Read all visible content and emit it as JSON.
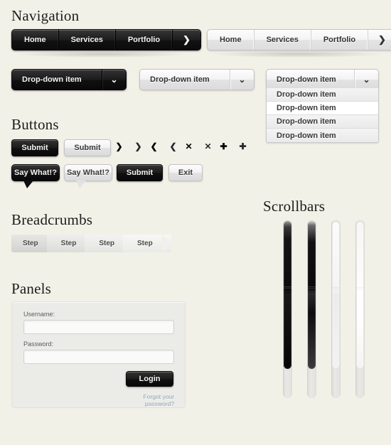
{
  "sections": {
    "navigation": "Navigation",
    "buttons": "Buttons",
    "breadcrumbs": "Breadcrumbs",
    "panels": "Panels",
    "scrollbars": "Scrollbars"
  },
  "navbar_dark": {
    "items": [
      "Home",
      "Services",
      "Portfolio"
    ],
    "arrow": "❯"
  },
  "navbar_light": {
    "items": [
      "Home",
      "Services",
      "Portfolio"
    ],
    "arrow": "❯"
  },
  "dropdowns": {
    "dark_label": "Drop-down item",
    "light_label": "Drop-down item",
    "open_label": "Drop-down item",
    "caret": "⌄",
    "list_items": [
      "Drop-down item",
      "Drop-down item",
      "Drop-down item",
      "Drop-down item"
    ],
    "active_index": 1
  },
  "buttons": {
    "submit_dark": "Submit",
    "submit_light": "Submit",
    "bubble_dark": "Say What!?",
    "bubble_light": "Say What!?",
    "submit_row2": "Submit",
    "exit": "Exit",
    "icons": [
      {
        "glyph": "❯",
        "name": "chevron-right-icon",
        "style": "dark"
      },
      {
        "glyph": "❯",
        "name": "chevron-right-icon",
        "style": "plain"
      },
      {
        "glyph": "❮",
        "name": "chevron-left-icon",
        "style": "dark"
      },
      {
        "glyph": "❮",
        "name": "chevron-left-icon",
        "style": "plain"
      },
      {
        "glyph": "✕",
        "name": "close-icon",
        "style": "dark"
      },
      {
        "glyph": "✕",
        "name": "close-icon",
        "style": "plain"
      },
      {
        "glyph": "✚",
        "name": "plus-icon",
        "style": "dark"
      },
      {
        "glyph": "✚",
        "name": "plus-icon",
        "style": "plain"
      }
    ]
  },
  "breadcrumbs": {
    "steps": [
      "Step",
      "Step",
      "Step",
      "Step"
    ]
  },
  "panel": {
    "username_label": "Username:",
    "password_label": "Password:",
    "username_value": "",
    "password_value": "",
    "login_label": "Login",
    "forgot_label": "Forgot your password?"
  },
  "colors": {
    "page_background": "#f2f1e8",
    "dark_fill": "#101010",
    "light_fill": "#eeeeee",
    "link": "#8ea4ae",
    "heading": "#1d1d1b"
  }
}
